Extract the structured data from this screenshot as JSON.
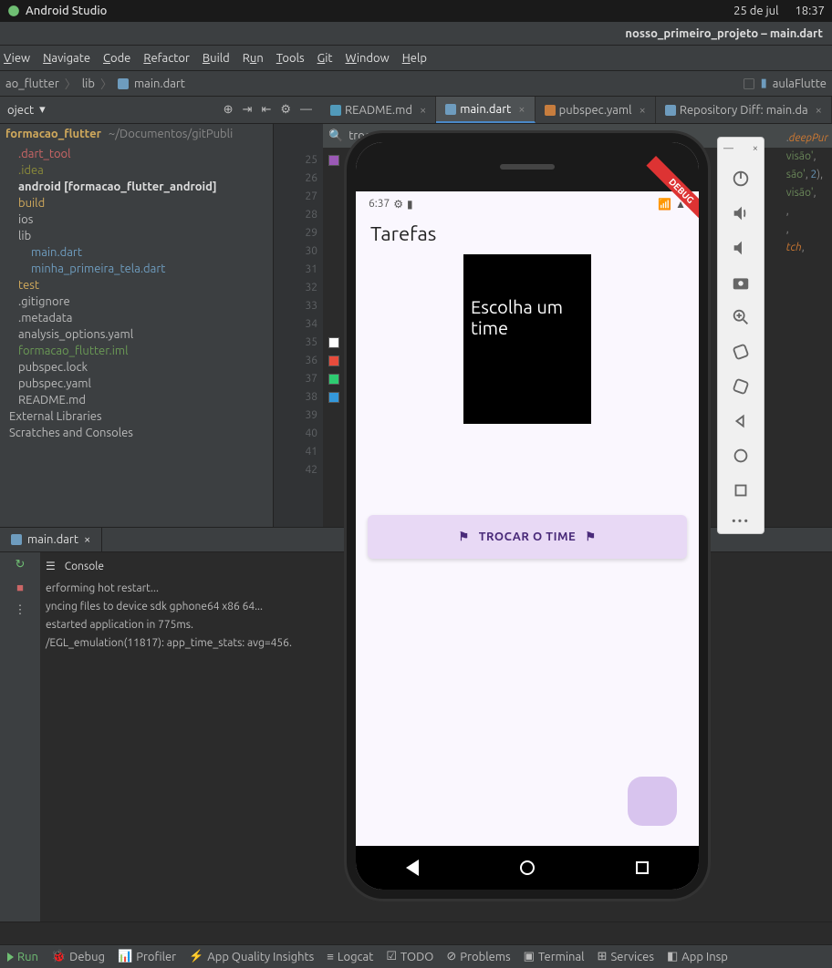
{
  "os": {
    "app": "Android Studio",
    "date": "25 de jul",
    "time": "18:37"
  },
  "window_title": "nosso_primeiro_projeto – main.dart",
  "menu": [
    "View",
    "Navigate",
    "Code",
    "Refactor",
    "Build",
    "Run",
    "Tools",
    "Git",
    "Window",
    "Help"
  ],
  "crumbs": {
    "c1": "ao_flutter",
    "c2": "lib",
    "c3": "main.dart"
  },
  "crumb_right": "aulaFlutte",
  "project_label": "oject",
  "tabs": [
    {
      "label": "README.md",
      "kind": "md"
    },
    {
      "label": "main.dart",
      "kind": "dart",
      "active": true
    },
    {
      "label": "pubspec.yaml",
      "kind": "yaml"
    },
    {
      "label": "Repository Diff: main.da",
      "kind": "diff"
    }
  ],
  "sidebar": {
    "project": "formacao_flutter",
    "path": "~/Documentos/gitPubli",
    "items": [
      {
        "label": ".dart_tool",
        "cls": "fold-red",
        "ind": 1
      },
      {
        "label": ".idea",
        "cls": "fold-g",
        "ind": 1
      },
      {
        "label": "android [formacao_flutter_android]",
        "cls": "",
        "ind": 1,
        "bold": true
      },
      {
        "label": "build",
        "cls": "txt-y",
        "ind": 1
      },
      {
        "label": "ios",
        "cls": "",
        "ind": 1
      },
      {
        "label": "lib",
        "cls": "",
        "ind": 1
      },
      {
        "label": "main.dart",
        "cls": "fold-b",
        "ind": 2
      },
      {
        "label": "minha_primeira_tela.dart",
        "cls": "fold-b",
        "ind": 2
      },
      {
        "label": "test",
        "cls": "txt-y",
        "ind": 1
      },
      {
        "label": ".gitignore",
        "cls": "",
        "ind": 1
      },
      {
        "label": ".metadata",
        "cls": "",
        "ind": 1
      },
      {
        "label": "analysis_options.yaml",
        "cls": "",
        "ind": 1
      },
      {
        "label": "formacao_flutter.iml",
        "cls": "txt-g",
        "ind": 1
      },
      {
        "label": "pubspec.lock",
        "cls": "",
        "ind": 1
      },
      {
        "label": "pubspec.yaml",
        "cls": "",
        "ind": 1
      },
      {
        "label": "README.md",
        "cls": "",
        "ind": 1
      },
      {
        "label": "External Libraries",
        "cls": "",
        "ind": 0
      },
      {
        "label": "Scratches and Consoles",
        "cls": "",
        "ind": 0
      }
    ]
  },
  "search": "trocaTime",
  "gutter_lines": [
    "25",
    "26",
    "27",
    "28",
    "29",
    "30",
    "31",
    "32",
    "33",
    "34",
    "35",
    "36",
    "37",
    "38",
    "39",
    "40",
    "41",
    "42"
  ],
  "swatches": [
    "#9b59b6",
    "",
    "",
    "",
    "",
    "",
    "",
    "",
    "",
    "",
    "#ffffff",
    "#e74c3c",
    "#2ecc71",
    "#3498db",
    "",
    "",
    "",
    ""
  ],
  "code_snips": [
    ".deepPur",
    "visão',",
    "são', 2),",
    "visão',",
    ",",
    ",",
    "tch,",
    ""
  ],
  "mid_tab": "main.dart",
  "console": {
    "header": "Console",
    "lines": [
      "erforming hot restart...",
      "yncing files to device sdk gphone64 x86 64...",
      "estarted application in 775ms.",
      "/EGL_emulation(11817): app_time_stats: avg=456."
    ]
  },
  "bottom": [
    "Run",
    "Debug",
    "Profiler",
    "App Quality Insights",
    "TODO",
    "Problems",
    "Terminal",
    "Services",
    "Logcat",
    "App Insp"
  ],
  "emulator": {
    "status_time": "6:37",
    "app_title": "Tarefas",
    "card_text": "Escolha um time",
    "button": "TROCAR O TIME"
  }
}
